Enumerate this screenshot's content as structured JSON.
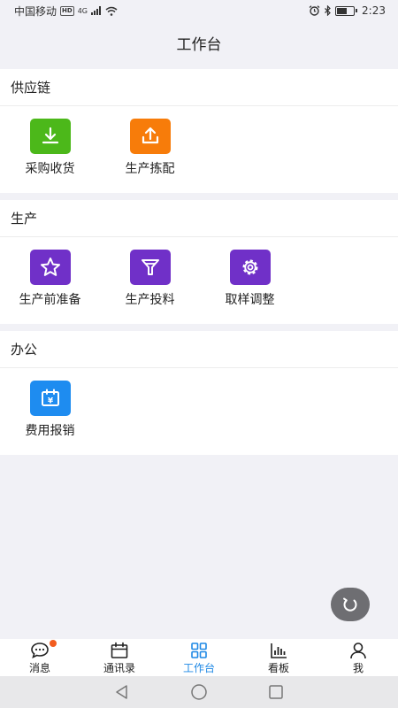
{
  "status": {
    "carrier": "中国移动",
    "hd": "HD",
    "network": "4G",
    "time": "2:23"
  },
  "header": {
    "title": "工作台"
  },
  "sections": [
    {
      "title": "供应链",
      "items": [
        {
          "label": "采购收货",
          "icon": "download-icon",
          "color": "#4cb81a"
        },
        {
          "label": "生产拣配",
          "icon": "upload-icon",
          "color": "#f77c0a"
        }
      ]
    },
    {
      "title": "生产",
      "items": [
        {
          "label": "生产前准备",
          "icon": "star-icon",
          "color": "#7030c8"
        },
        {
          "label": "生产投料",
          "icon": "funnel-icon",
          "color": "#7030c8"
        },
        {
          "label": "取样调整",
          "icon": "gear-icon",
          "color": "#7030c8"
        }
      ]
    },
    {
      "title": "办公",
      "items": [
        {
          "label": "费用报销",
          "icon": "yuan-calendar-icon",
          "color": "#1e8cf0"
        }
      ]
    }
  ],
  "tabs": [
    {
      "label": "消息",
      "icon": "message-icon",
      "badge": true
    },
    {
      "label": "通讯录",
      "icon": "contacts-icon"
    },
    {
      "label": "工作台",
      "icon": "grid-icon",
      "active": true
    },
    {
      "label": "看板",
      "icon": "chart-icon"
    },
    {
      "label": "我",
      "icon": "person-icon"
    }
  ],
  "colors": {
    "active_tab": "#1e88e5",
    "badge": "#f25c1e"
  }
}
